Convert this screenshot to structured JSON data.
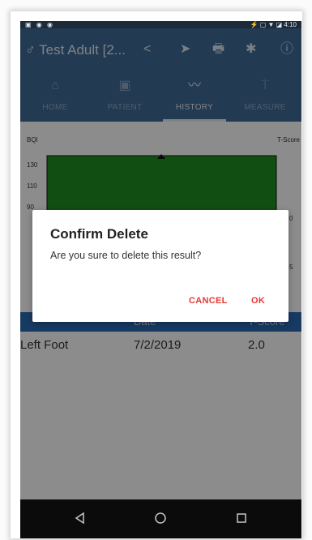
{
  "status_bar": {
    "left_icons": "▣ ◉ ◉",
    "right_icons": "⚡ ▢ ▼ ◪",
    "time": "4:10"
  },
  "app_bar": {
    "title": "♂ Test Adult [2...",
    "icons": [
      "share-icon",
      "send-icon",
      "print-icon",
      "settings-icon",
      "info-icon"
    ],
    "icon_glyphs": [
      "<",
      "➤",
      "🖶",
      "✱",
      "ⓘ"
    ]
  },
  "tabs": [
    {
      "label": "HOME",
      "icon": "home-icon",
      "glyph": "⌂",
      "active": false
    },
    {
      "label": "PATIENT",
      "icon": "patient-icon",
      "glyph": "▣",
      "active": false
    },
    {
      "label": "HISTORY",
      "icon": "history-icon",
      "glyph": "〰",
      "active": true
    },
    {
      "label": "MEASURE",
      "icon": "measure-icon",
      "glyph": "⍑",
      "active": false
    }
  ],
  "chart": {
    "ylabel": "BQI",
    "y2label": "T-Score",
    "yticks": [
      "130",
      "110",
      "90"
    ],
    "y2ticks": [
      "0",
      "5"
    ],
    "fill_color": "#1f8f1f"
  },
  "table": {
    "headers": [
      "Date",
      "T-Score"
    ],
    "rows": [
      {
        "site": "Left Foot",
        "date": "7/2/2019",
        "score": "2.0"
      }
    ]
  },
  "dialog": {
    "title": "Confirm Delete",
    "message": "Are you sure to delete this result?",
    "cancel_label": "CANCEL",
    "ok_label": "OK",
    "button_color": "#e53935"
  }
}
